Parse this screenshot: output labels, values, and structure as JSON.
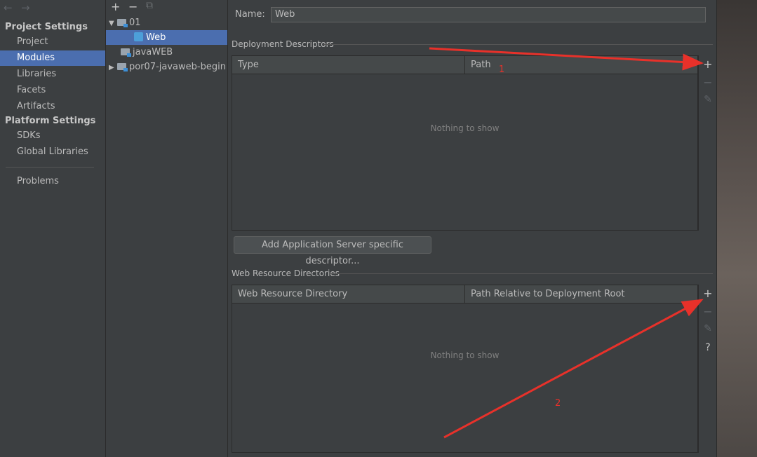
{
  "nav": {
    "back": "←",
    "forward": "→",
    "project_settings": "Project Settings",
    "project_items": [
      "Project",
      "Modules",
      "Libraries",
      "Facets",
      "Artifacts"
    ],
    "platform_settings": "Platform Settings",
    "platform_items": [
      "SDKs",
      "Global Libraries"
    ],
    "problems": "Problems",
    "selected": "Modules"
  },
  "tree": {
    "toolbar": {
      "add": "+",
      "remove": "−",
      "copy": "⧉"
    },
    "nodes": [
      {
        "label": "01",
        "expanded": true
      },
      {
        "label": "Web",
        "selected": true
      },
      {
        "label": "javaWEB"
      },
      {
        "label": "por07-javaweb-begin",
        "expanded": false
      }
    ]
  },
  "facet": {
    "name_label": "Name:",
    "name_value": "Web",
    "deployment": {
      "title": "Deployment Descriptors",
      "columns": [
        "Type",
        "Path"
      ],
      "empty": "Nothing to show",
      "add": "+",
      "remove": "−",
      "edit": "✎"
    },
    "add_descriptor_button": "Add Application Server specific descriptor...",
    "resources": {
      "title": "Web Resource Directories",
      "columns": [
        "Web Resource Directory",
        "Path Relative to Deployment Root"
      ],
      "empty": "Nothing to show",
      "add": "+",
      "remove": "−",
      "edit": "✎",
      "help": "?"
    }
  },
  "annotations": {
    "label1": "1",
    "label2": "2",
    "color": "#e8312a"
  }
}
